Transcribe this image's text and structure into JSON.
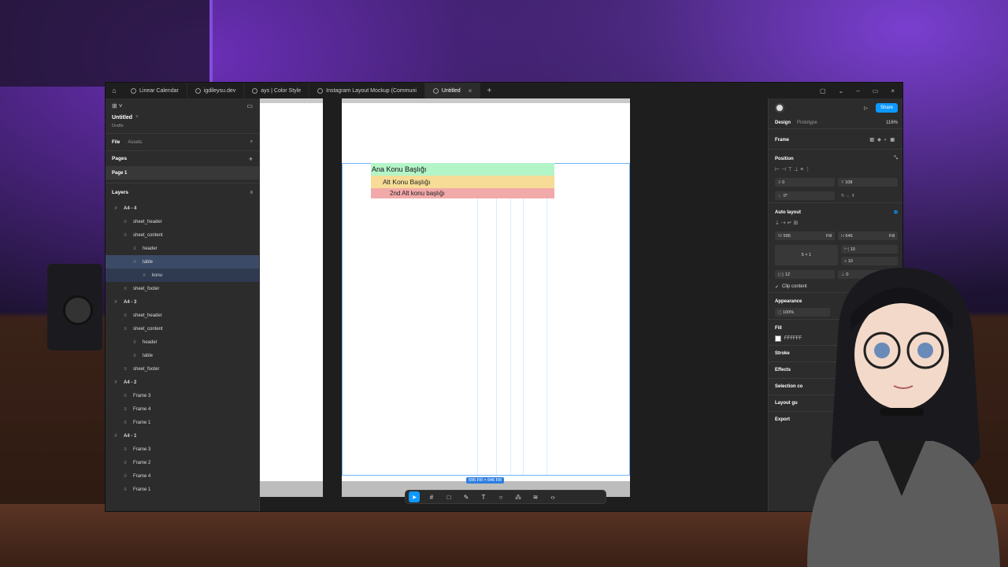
{
  "tabs": [
    {
      "label": "Linear Calendar",
      "active": false
    },
    {
      "label": "igdileysu.dev",
      "active": false
    },
    {
      "label": "ays | Color Style",
      "active": false
    },
    {
      "label": "Instagram Layout Mockup (Communi",
      "active": false
    },
    {
      "label": "Untitled",
      "active": true
    }
  ],
  "left_panel": {
    "file_name": "Untitled",
    "file_location": "Drafts",
    "tab_file": "File",
    "tab_assets": "Assets",
    "pages_heading": "Pages",
    "page_1": "Page 1",
    "layers_heading": "Layers",
    "layers": [
      {
        "label": "A4 - 4",
        "level": 0,
        "state": ""
      },
      {
        "label": "sheet_header",
        "level": 1,
        "state": ""
      },
      {
        "label": "sheet_content",
        "level": 1,
        "state": ""
      },
      {
        "label": "header",
        "level": 2,
        "state": ""
      },
      {
        "label": "table",
        "level": 2,
        "state": "selected"
      },
      {
        "label": "konu",
        "level": 3,
        "state": "child"
      },
      {
        "label": "sheet_footer",
        "level": 1,
        "state": ""
      },
      {
        "label": "A4 - 3",
        "level": 0,
        "state": ""
      },
      {
        "label": "sheet_header",
        "level": 1,
        "state": ""
      },
      {
        "label": "sheet_content",
        "level": 1,
        "state": ""
      },
      {
        "label": "header",
        "level": 2,
        "state": ""
      },
      {
        "label": "table",
        "level": 2,
        "state": ""
      },
      {
        "label": "sheet_footer",
        "level": 1,
        "state": ""
      },
      {
        "label": "A4 - 2",
        "level": 0,
        "state": ""
      },
      {
        "label": "Frame 3",
        "level": 1,
        "state": ""
      },
      {
        "label": "Frame 4",
        "level": 1,
        "state": ""
      },
      {
        "label": "Frame 1",
        "level": 1,
        "state": ""
      },
      {
        "label": "A4 - 1",
        "level": 0,
        "state": ""
      },
      {
        "label": "Frame 3",
        "level": 1,
        "state": ""
      },
      {
        "label": "Frame 2",
        "level": 1,
        "state": ""
      },
      {
        "label": "Frame 4",
        "level": 1,
        "state": ""
      },
      {
        "label": "Frame 1",
        "level": 1,
        "state": ""
      }
    ]
  },
  "canvas": {
    "row_ana": "Ana Konu Başlığı",
    "row_alt": "Alt Konu Başlığı",
    "row_2nd": "2nd Alt konu başlığı",
    "size_label": "595 Fill × 646 Fill",
    "colors": {
      "ana": "#b4f5c8",
      "alt": "#f6dc96",
      "second": "#f2a9a9"
    }
  },
  "right_panel": {
    "share": "Share",
    "tab_design": "Design",
    "tab_prototype": "Prototype",
    "zoom": "116%",
    "frame_label": "Frame",
    "position_heading": "Position",
    "x_value": "0",
    "y_value": "108",
    "rotation": "0°",
    "auto_layout_heading": "Auto layout",
    "w_label": "W",
    "w_value": "595",
    "w_mode": "Fill",
    "h_label": "H",
    "h_value": "646",
    "h_mode": "Fill",
    "gap_h": "10",
    "gap_v": "10",
    "grid_label": "5 × 1",
    "padding_h": "12",
    "padding_v": "0",
    "clip_content": "Clip content",
    "appearance_heading": "Appearance",
    "opacity": "100%",
    "fill_heading": "Fill",
    "fill_value": "FFFFFF",
    "stroke_heading": "Stroke",
    "effects_heading": "Effects",
    "selection_colors_heading": "Selection co",
    "layout_guide_heading": "Layout gu",
    "export_heading": "Export"
  }
}
